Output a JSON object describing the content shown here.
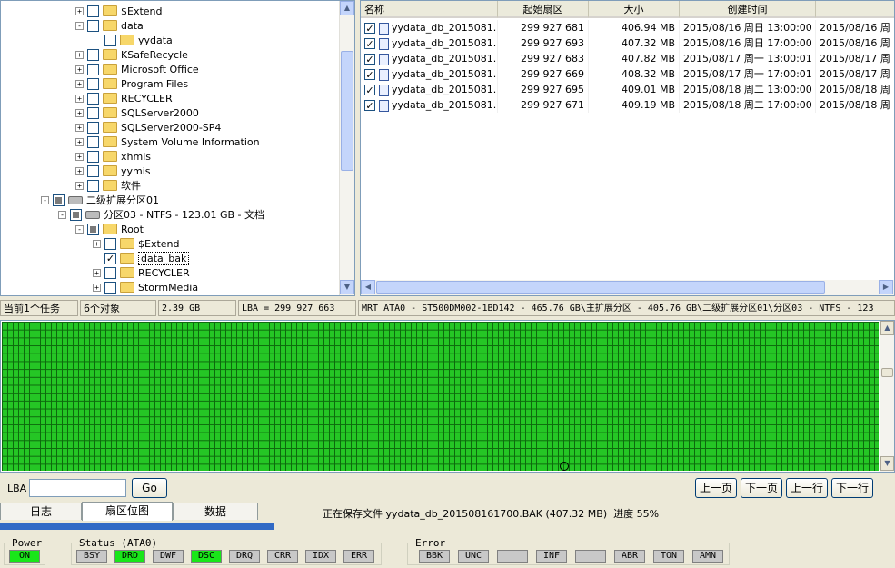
{
  "tree": {
    "items": [
      {
        "label": "$Extend",
        "type": "folder",
        "indent": 4,
        "expander": "+",
        "check": "none"
      },
      {
        "label": "data",
        "type": "folder",
        "indent": 4,
        "expander": "-",
        "check": "none"
      },
      {
        "label": "yydata",
        "type": "folder",
        "indent": 5,
        "expander": "",
        "check": "none"
      },
      {
        "label": "KSafeRecycle",
        "type": "folder",
        "indent": 4,
        "expander": "+",
        "check": "none"
      },
      {
        "label": "Microsoft Office",
        "type": "folder",
        "indent": 4,
        "expander": "+",
        "check": "none"
      },
      {
        "label": "Program Files",
        "type": "folder",
        "indent": 4,
        "expander": "+",
        "check": "none"
      },
      {
        "label": "RECYCLER",
        "type": "folder",
        "indent": 4,
        "expander": "+",
        "check": "none"
      },
      {
        "label": "SQLServer2000",
        "type": "folder",
        "indent": 4,
        "expander": "+",
        "check": "none"
      },
      {
        "label": "SQLServer2000-SP4",
        "type": "folder",
        "indent": 4,
        "expander": "+",
        "check": "none"
      },
      {
        "label": "System Volume Information",
        "type": "folder",
        "indent": 4,
        "expander": "+",
        "check": "none"
      },
      {
        "label": "xhmis",
        "type": "folder",
        "indent": 4,
        "expander": "+",
        "check": "none"
      },
      {
        "label": "yymis",
        "type": "folder",
        "indent": 4,
        "expander": "+",
        "check": "none"
      },
      {
        "label": "软件",
        "type": "folder",
        "indent": 4,
        "expander": "+",
        "check": "none"
      },
      {
        "label": "二级扩展分区01",
        "type": "drive",
        "indent": 2,
        "expander": "-",
        "check": "partial"
      },
      {
        "label": "分区03 - NTFS - 123.01 GB - 文档",
        "type": "drive",
        "indent": 3,
        "expander": "-",
        "check": "partial"
      },
      {
        "label": "Root",
        "type": "folder",
        "indent": 4,
        "expander": "-",
        "check": "partial"
      },
      {
        "label": "$Extend",
        "type": "folder",
        "indent": 5,
        "expander": "+",
        "check": "none"
      },
      {
        "label": "data_bak",
        "type": "folder",
        "indent": 5,
        "expander": "",
        "check": "on"
      },
      {
        "label": "RECYCLER",
        "type": "folder",
        "indent": 5,
        "expander": "+",
        "check": "none"
      },
      {
        "label": "StormMedia",
        "type": "folder",
        "indent": 5,
        "expander": "+",
        "check": "none"
      }
    ]
  },
  "list": {
    "columns": [
      "名称",
      "起始扇区",
      "大小",
      "创建时间",
      ""
    ],
    "rows": [
      {
        "name": "yydata_db_2015081...",
        "sector": "299 927 681",
        "size": "406.94 MB",
        "created": "2015/08/16 周日 13:00:00",
        "modified": "2015/08/16 周"
      },
      {
        "name": "yydata_db_2015081...",
        "sector": "299 927 693",
        "size": "407.32 MB",
        "created": "2015/08/16 周日 17:00:00",
        "modified": "2015/08/16 周"
      },
      {
        "name": "yydata_db_2015081...",
        "sector": "299 927 683",
        "size": "407.82 MB",
        "created": "2015/08/17 周一 13:00:01",
        "modified": "2015/08/17 周"
      },
      {
        "name": "yydata_db_2015081...",
        "sector": "299 927 669",
        "size": "408.32 MB",
        "created": "2015/08/17 周一 17:00:01",
        "modified": "2015/08/17 周"
      },
      {
        "name": "yydata_db_2015081...",
        "sector": "299 927 695",
        "size": "409.01 MB",
        "created": "2015/08/18 周二 13:00:00",
        "modified": "2015/08/18 周"
      },
      {
        "name": "yydata_db_2015081...",
        "sector": "299 927 671",
        "size": "409.19 MB",
        "created": "2015/08/18 周二 17:00:00",
        "modified": "2015/08/18 周"
      }
    ]
  },
  "status": {
    "tasks": "当前1个任务",
    "objects": "6个对象",
    "size": "2.39 GB",
    "lba": "LBA = 299 927 663",
    "path": "MRT ATA0 - ST500DM002-1BD142 - 465.76 GB\\主扩展分区 - 405.76 GB\\二级扩展分区01\\分区03 - NTFS - 123"
  },
  "nav": {
    "lba_label": "LBA",
    "lba_value": "",
    "go": "Go",
    "prev_page": "上一页",
    "next_page": "下一页",
    "prev_line": "上一行",
    "next_line": "下一行"
  },
  "tabs": [
    "日志",
    "扇区位图",
    "数据"
  ],
  "progress": {
    "text": "正在保存文件 yydata_db_201508161700.BAK (407.32 MB)  进度 55%",
    "percent": 55
  },
  "panels": {
    "power_title": "Power",
    "power": [
      {
        "label": "ON",
        "on": true
      }
    ],
    "status_title": "Status (ATA0)",
    "status": [
      {
        "label": "BSY",
        "on": false
      },
      {
        "label": "DRD",
        "on": true
      },
      {
        "label": "DWF",
        "on": false
      },
      {
        "label": "DSC",
        "on": true
      },
      {
        "label": "DRQ",
        "on": false
      },
      {
        "label": "CRR",
        "on": false
      },
      {
        "label": "IDX",
        "on": false
      },
      {
        "label": "ERR",
        "on": false
      }
    ],
    "error_title": "Error",
    "error": [
      {
        "label": "BBK",
        "on": false
      },
      {
        "label": "UNC",
        "on": false
      },
      {
        "label": "",
        "on": false
      },
      {
        "label": "INF",
        "on": false
      },
      {
        "label": "",
        "on": false
      },
      {
        "label": "ABR",
        "on": false
      },
      {
        "label": "TON",
        "on": false
      },
      {
        "label": "AMN",
        "on": false
      }
    ]
  },
  "colors": {
    "ok_green": "#25c625",
    "led_on": "#19e619",
    "progress": "#316ac5"
  }
}
